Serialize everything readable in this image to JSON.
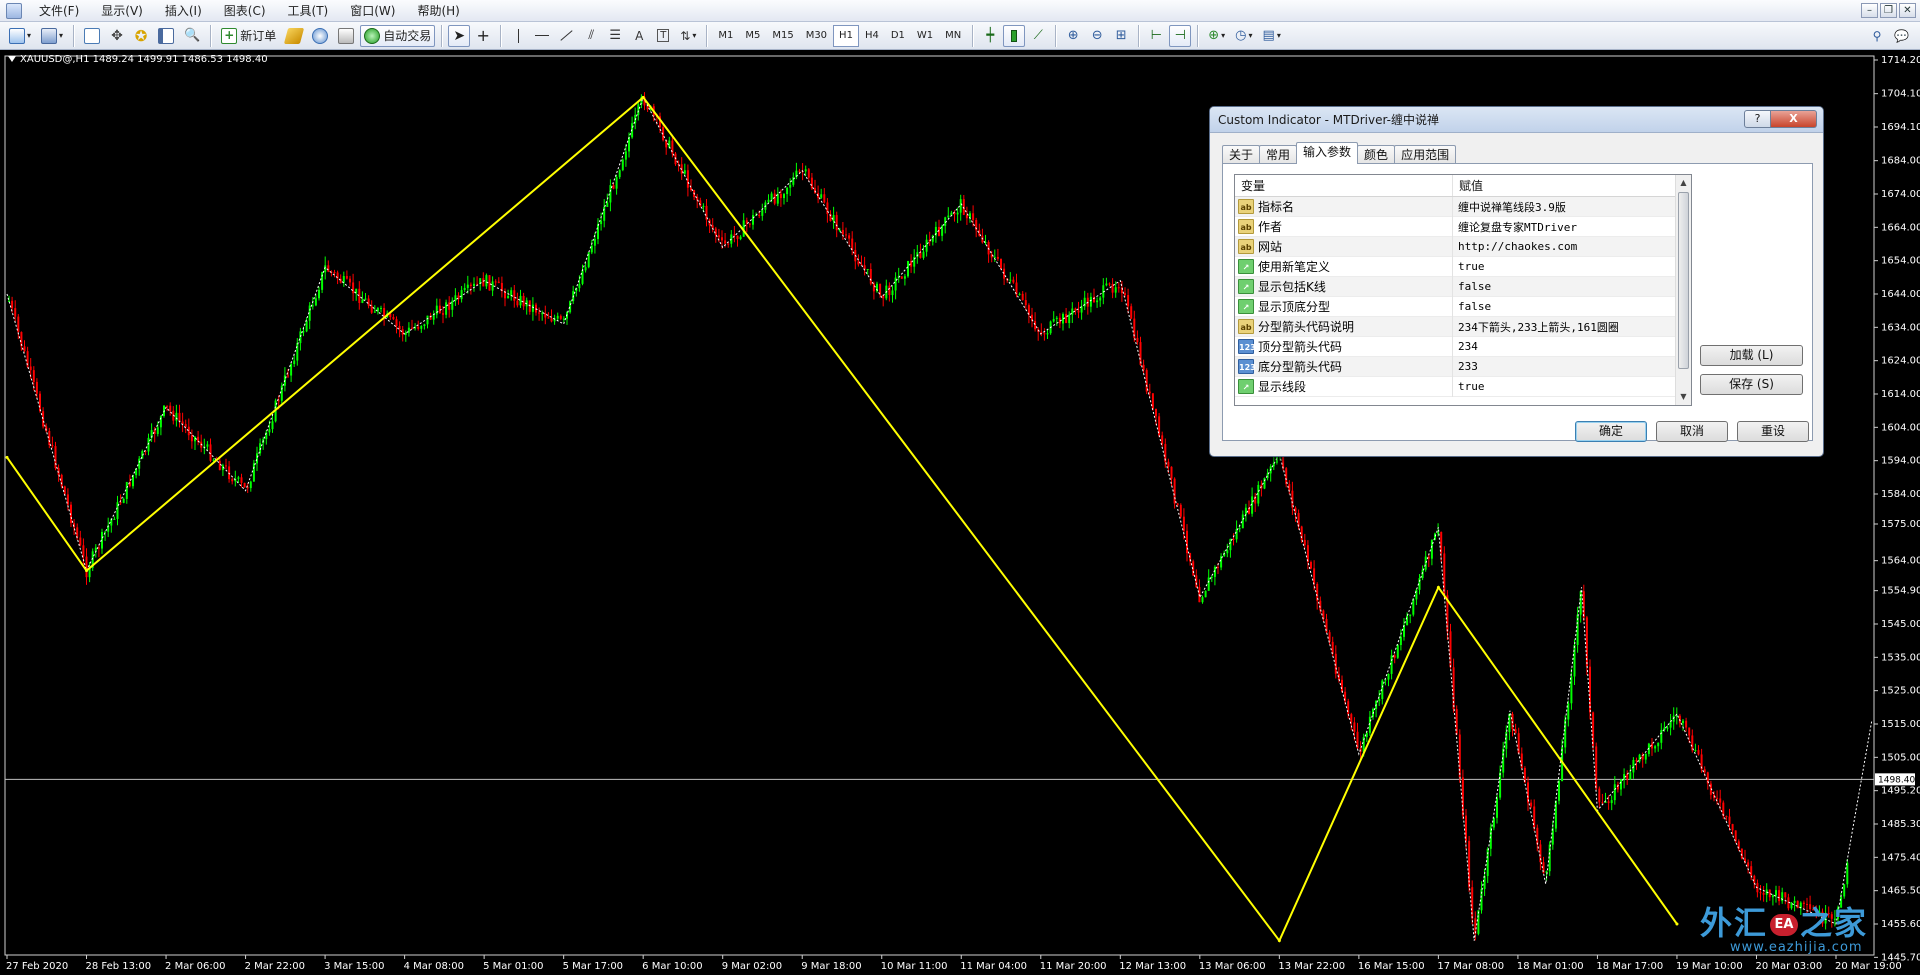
{
  "menu": [
    "文件(F)",
    "显示(V)",
    "插入(I)",
    "图表(C)",
    "工具(T)",
    "窗口(W)",
    "帮助(H)"
  ],
  "toolbar": {
    "new_order_label": "新订单",
    "auto_trade_label": "自动交易",
    "timeframes": [
      "M1",
      "M5",
      "M15",
      "M30",
      "H1",
      "H4",
      "D1",
      "W1",
      "MN"
    ],
    "active_timeframe": "H1"
  },
  "chart": {
    "symbol_info": "XAUUSD@,H1  1489.24 1499.91 1486.53 1498.40",
    "current_price_label": "1498.40",
    "watermark_brand_left": "外汇",
    "watermark_seal": "EA",
    "watermark_brand_right": "之家",
    "watermark_url": "www.eazhijia.com",
    "colors": {
      "bull": "#00ff00",
      "bear": "#ff0000",
      "stroke": "#ffff00",
      "pen": "#ffffff",
      "bg": "#000000"
    }
  },
  "chart_data": {
    "type": "candlestick",
    "ylim": [
      1445.7,
      1714.2
    ],
    "y_ticks": [
      1714.2,
      1704.1,
      1694.1,
      1684.0,
      1674.0,
      1664.0,
      1654.0,
      1644.0,
      1634.0,
      1624.0,
      1614.0,
      1604.0,
      1594.0,
      1584.0,
      1575.0,
      1564.0,
      1555.0,
      1545.0,
      1535.0,
      1525.0,
      1515.0,
      1505.0,
      1495.0,
      1485.0,
      1475.0,
      1465.0,
      1455.0,
      1445.0
    ],
    "y_tick_labels": [
      "1714.20",
      "1704.10",
      "1694.10",
      "1684.00",
      "1674.00",
      "1664.00",
      "1654.00",
      "1644.00",
      "1634.00",
      "1624.00",
      "1614.00",
      "1604.00",
      "1594.00",
      "1584.00",
      "1575.00",
      "1564.00",
      "1554.90",
      "1545.00",
      "1535.00",
      "1525.00",
      "1515.00",
      "1505.00",
      "1495.20",
      "1485.30",
      "1475.40",
      "1465.50",
      "1455.60",
      "1445.70"
    ],
    "x_tick_labels": [
      "27 Feb 2020",
      "28 Feb 13:00",
      "2 Mar 06:00",
      "2 Mar 22:00",
      "3 Mar 15:00",
      "4 Mar 08:00",
      "5 Mar 01:00",
      "5 Mar 17:00",
      "6 Mar 10:00",
      "9 Mar 02:00",
      "9 Mar 18:00",
      "10 Mar 11:00",
      "11 Mar 04:00",
      "11 Mar 20:00",
      "12 Mar 13:00",
      "13 Mar 06:00",
      "13 Mar 22:00",
      "16 Mar 15:00",
      "17 Mar 08:00",
      "18 Mar 01:00",
      "18 Mar 17:00",
      "19 Mar 10:00",
      "20 Mar 03:00",
      "20 Mar 19:00"
    ],
    "last_price": 1498.4,
    "stroke_points": [
      {
        "x": "27 Feb 2020",
        "y": 1595
      },
      {
        "x": "28 Feb 13:00",
        "y": 1561
      },
      {
        "x": "6 Mar 10:00",
        "y": 1703
      },
      {
        "x": "13 Mar 22:00",
        "y": 1450
      },
      {
        "x": "17 Mar 08:00",
        "y": 1556
      },
      {
        "x": "19 Mar 10:00",
        "y": 1455
      }
    ],
    "pen_points": [
      {
        "x": "27 Feb 2020",
        "y": 1644
      },
      {
        "x": "28 Feb 13:00",
        "y": 1561
      },
      {
        "x": "2 Mar 06:00",
        "y": 1610
      },
      {
        "x": "2 Mar 22:00",
        "y": 1585
      },
      {
        "x": "3 Mar 15:00",
        "y": 1652
      },
      {
        "x": "4 Mar 08:00",
        "y": 1632
      },
      {
        "x": "5 Mar 01:00",
        "y": 1648
      },
      {
        "x": "5 Mar 17:00",
        "y": 1635
      },
      {
        "x": "6 Mar 10:00",
        "y": 1703
      },
      {
        "x": "9 Mar 02:00",
        "y": 1658
      },
      {
        "x": "9 Mar 18:00",
        "y": 1681
      },
      {
        "x": "10 Mar 11:00",
        "y": 1643
      },
      {
        "x": "11 Mar 04:00",
        "y": 1671
      },
      {
        "x": "11 Mar 20:00",
        "y": 1632
      },
      {
        "x": "12 Mar 13:00",
        "y": 1648
      },
      {
        "x": "13 Mar 06:00",
        "y": 1553
      },
      {
        "x": "13 Mar 22:00",
        "y": 1596
      },
      {
        "x": "16 Mar 15:00",
        "y": 1506
      },
      {
        "x": "17 Mar 08:00",
        "y": 1574
      },
      {
        "x": "13 Mar 22:00",
        "y": 1450
      },
      {
        "x": "16 Mar 15:00",
        "y": 1519
      },
      {
        "x": "17 Mar 08:00",
        "y": 1467
      },
      {
        "x": "18 Mar 01:00",
        "y": 1556
      },
      {
        "x": "18 Mar 17:00",
        "y": 1489
      },
      {
        "x": "19 Mar 10:00",
        "y": 1518
      },
      {
        "x": "20 Mar 03:00",
        "y": 1466
      },
      {
        "x": "20 Mar 19:00",
        "y": 1455
      },
      {
        "x": "20 Mar 19:00",
        "y": 1516
      }
    ]
  },
  "dialog": {
    "title": "Custom Indicator - MTDriver-缠中说禅",
    "help_label": "?",
    "close_label": "X",
    "tabs": [
      "关于",
      "常用",
      "输入参数",
      "颜色",
      "应用范围"
    ],
    "active_tab": "输入参数",
    "col_variable": "变量",
    "col_value": "赋值",
    "params": [
      {
        "type": "ab",
        "name": "指标名",
        "value": "缠中说禅笔线段3.9版"
      },
      {
        "type": "ab",
        "name": "作者",
        "value": "缠论复盘专家MTDriver"
      },
      {
        "type": "ab",
        "name": "网站",
        "value": "http://chaokes.com"
      },
      {
        "type": "bool",
        "name": "使用新笔定义",
        "value": "true"
      },
      {
        "type": "bool",
        "name": "显示包括K线",
        "value": "false"
      },
      {
        "type": "bool",
        "name": "显示顶底分型",
        "value": "false"
      },
      {
        "type": "ab",
        "name": "分型箭头代码说明",
        "value": "234下箭头,233上箭头,161圆圈"
      },
      {
        "type": "num",
        "name": "顶分型箭头代码",
        "value": "234"
      },
      {
        "type": "num",
        "name": "底分型箭头代码",
        "value": "233"
      },
      {
        "type": "bool",
        "name": "显示线段",
        "value": "true"
      }
    ],
    "load_label": "加载 (L)",
    "save_label": "保存 (S)",
    "ok_label": "确定",
    "cancel_label": "取消",
    "reset_label": "重设"
  }
}
